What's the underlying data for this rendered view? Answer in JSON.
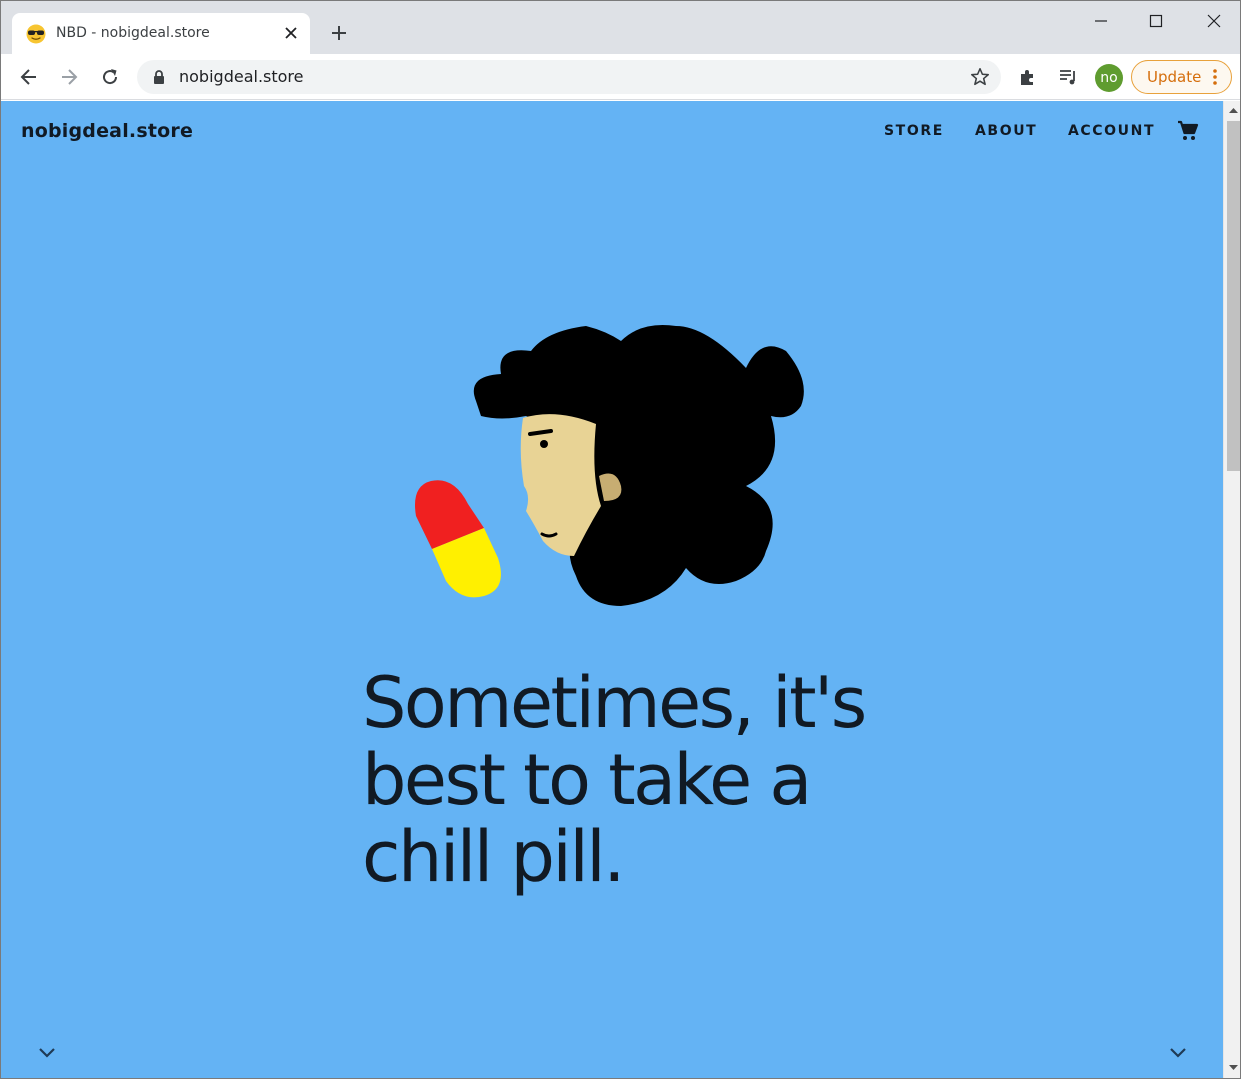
{
  "browser": {
    "tab": {
      "title": "NBD - nobigdeal.store",
      "favicon": "sunglasses-emoji-icon"
    },
    "url": "nobigdeal.store",
    "profile_initials": "no",
    "update_label": "Update",
    "colors": {
      "tab_strip": "#dee1e6",
      "update_accent": "#d56e0c",
      "profile": "#5f9c2f"
    }
  },
  "site": {
    "brand": "nobigdeal.store",
    "nav": [
      {
        "label": "STORE"
      },
      {
        "label": "ABOUT"
      },
      {
        "label": "ACCOUNT"
      }
    ],
    "hero": {
      "headline_lines": [
        "Sometimes, it's",
        "best to take a",
        "chill pill."
      ]
    },
    "colors": {
      "background": "#64b3f4",
      "text": "#111a24",
      "pill_top": "#f02020",
      "pill_bottom": "#fff000",
      "skin": "#e8d395",
      "hair": "#000000"
    }
  }
}
